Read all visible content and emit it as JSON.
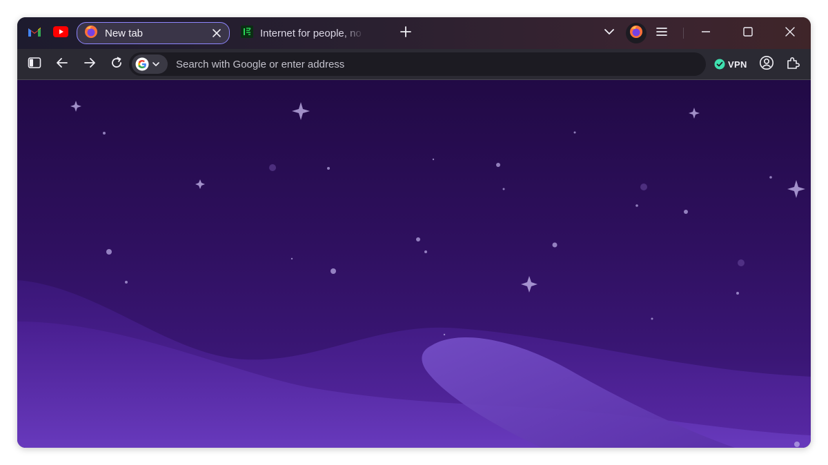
{
  "browser": {
    "pinned_tabs": [
      {
        "name": "gmail",
        "icon": "gmail-icon"
      },
      {
        "name": "youtube",
        "icon": "youtube-icon"
      }
    ],
    "tabs": [
      {
        "title": "New tab",
        "icon": "firefox-icon",
        "active": true
      },
      {
        "title": "Internet for people, no",
        "icon": "mozilla-icon",
        "active": false
      }
    ],
    "new_tab_icon": "plus-icon",
    "list_tabs_icon": "chevron-down-icon",
    "account_icon": "firefox-account-icon",
    "menu_icon": "hamburger-menu-icon",
    "window_controls": [
      "minimize-icon",
      "maximize-icon",
      "close-icon"
    ]
  },
  "toolbar": {
    "sidebar_icon": "sidebar-toggle-icon",
    "back_icon": "back-arrow-icon",
    "forward_icon": "forward-arrow-icon",
    "reload_icon": "reload-icon",
    "search_engine": "Google",
    "url_placeholder": "Search with Google or enter address",
    "vpn_label": "VPN",
    "vpn_status_color": "#3fe1b0",
    "profile_icon": "account-icon",
    "extensions_icon": "extensions-icon"
  },
  "colors": {
    "accent": "#8f86ff",
    "gmail_red": "#ea4335",
    "youtube_red": "#ff0000",
    "content_top": "#210a45",
    "content_bottom": "#4a2290"
  }
}
